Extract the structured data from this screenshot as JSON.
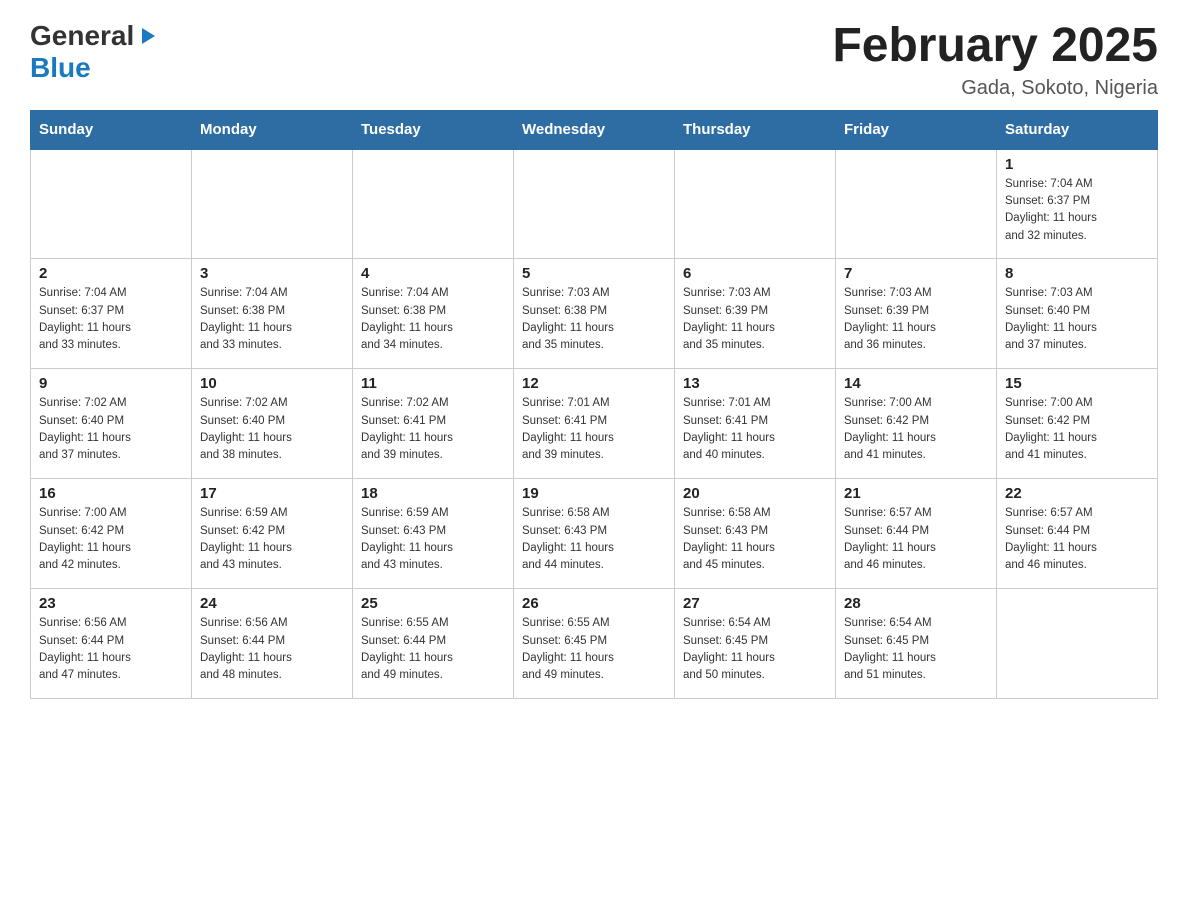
{
  "header": {
    "logo_general": "General",
    "logo_blue": "Blue",
    "month_title": "February 2025",
    "location": "Gada, Sokoto, Nigeria"
  },
  "calendar": {
    "days_of_week": [
      "Sunday",
      "Monday",
      "Tuesday",
      "Wednesday",
      "Thursday",
      "Friday",
      "Saturday"
    ],
    "weeks": [
      {
        "days": [
          {
            "num": "",
            "info": ""
          },
          {
            "num": "",
            "info": ""
          },
          {
            "num": "",
            "info": ""
          },
          {
            "num": "",
            "info": ""
          },
          {
            "num": "",
            "info": ""
          },
          {
            "num": "",
            "info": ""
          },
          {
            "num": "1",
            "info": "Sunrise: 7:04 AM\nSunset: 6:37 PM\nDaylight: 11 hours\nand 32 minutes."
          }
        ]
      },
      {
        "days": [
          {
            "num": "2",
            "info": "Sunrise: 7:04 AM\nSunset: 6:37 PM\nDaylight: 11 hours\nand 33 minutes."
          },
          {
            "num": "3",
            "info": "Sunrise: 7:04 AM\nSunset: 6:38 PM\nDaylight: 11 hours\nand 33 minutes."
          },
          {
            "num": "4",
            "info": "Sunrise: 7:04 AM\nSunset: 6:38 PM\nDaylight: 11 hours\nand 34 minutes."
          },
          {
            "num": "5",
            "info": "Sunrise: 7:03 AM\nSunset: 6:38 PM\nDaylight: 11 hours\nand 35 minutes."
          },
          {
            "num": "6",
            "info": "Sunrise: 7:03 AM\nSunset: 6:39 PM\nDaylight: 11 hours\nand 35 minutes."
          },
          {
            "num": "7",
            "info": "Sunrise: 7:03 AM\nSunset: 6:39 PM\nDaylight: 11 hours\nand 36 minutes."
          },
          {
            "num": "8",
            "info": "Sunrise: 7:03 AM\nSunset: 6:40 PM\nDaylight: 11 hours\nand 37 minutes."
          }
        ]
      },
      {
        "days": [
          {
            "num": "9",
            "info": "Sunrise: 7:02 AM\nSunset: 6:40 PM\nDaylight: 11 hours\nand 37 minutes."
          },
          {
            "num": "10",
            "info": "Sunrise: 7:02 AM\nSunset: 6:40 PM\nDaylight: 11 hours\nand 38 minutes."
          },
          {
            "num": "11",
            "info": "Sunrise: 7:02 AM\nSunset: 6:41 PM\nDaylight: 11 hours\nand 39 minutes."
          },
          {
            "num": "12",
            "info": "Sunrise: 7:01 AM\nSunset: 6:41 PM\nDaylight: 11 hours\nand 39 minutes."
          },
          {
            "num": "13",
            "info": "Sunrise: 7:01 AM\nSunset: 6:41 PM\nDaylight: 11 hours\nand 40 minutes."
          },
          {
            "num": "14",
            "info": "Sunrise: 7:00 AM\nSunset: 6:42 PM\nDaylight: 11 hours\nand 41 minutes."
          },
          {
            "num": "15",
            "info": "Sunrise: 7:00 AM\nSunset: 6:42 PM\nDaylight: 11 hours\nand 41 minutes."
          }
        ]
      },
      {
        "days": [
          {
            "num": "16",
            "info": "Sunrise: 7:00 AM\nSunset: 6:42 PM\nDaylight: 11 hours\nand 42 minutes."
          },
          {
            "num": "17",
            "info": "Sunrise: 6:59 AM\nSunset: 6:42 PM\nDaylight: 11 hours\nand 43 minutes."
          },
          {
            "num": "18",
            "info": "Sunrise: 6:59 AM\nSunset: 6:43 PM\nDaylight: 11 hours\nand 43 minutes."
          },
          {
            "num": "19",
            "info": "Sunrise: 6:58 AM\nSunset: 6:43 PM\nDaylight: 11 hours\nand 44 minutes."
          },
          {
            "num": "20",
            "info": "Sunrise: 6:58 AM\nSunset: 6:43 PM\nDaylight: 11 hours\nand 45 minutes."
          },
          {
            "num": "21",
            "info": "Sunrise: 6:57 AM\nSunset: 6:44 PM\nDaylight: 11 hours\nand 46 minutes."
          },
          {
            "num": "22",
            "info": "Sunrise: 6:57 AM\nSunset: 6:44 PM\nDaylight: 11 hours\nand 46 minutes."
          }
        ]
      },
      {
        "days": [
          {
            "num": "23",
            "info": "Sunrise: 6:56 AM\nSunset: 6:44 PM\nDaylight: 11 hours\nand 47 minutes."
          },
          {
            "num": "24",
            "info": "Sunrise: 6:56 AM\nSunset: 6:44 PM\nDaylight: 11 hours\nand 48 minutes."
          },
          {
            "num": "25",
            "info": "Sunrise: 6:55 AM\nSunset: 6:44 PM\nDaylight: 11 hours\nand 49 minutes."
          },
          {
            "num": "26",
            "info": "Sunrise: 6:55 AM\nSunset: 6:45 PM\nDaylight: 11 hours\nand 49 minutes."
          },
          {
            "num": "27",
            "info": "Sunrise: 6:54 AM\nSunset: 6:45 PM\nDaylight: 11 hours\nand 50 minutes."
          },
          {
            "num": "28",
            "info": "Sunrise: 6:54 AM\nSunset: 6:45 PM\nDaylight: 11 hours\nand 51 minutes."
          },
          {
            "num": "",
            "info": ""
          }
        ]
      }
    ]
  }
}
